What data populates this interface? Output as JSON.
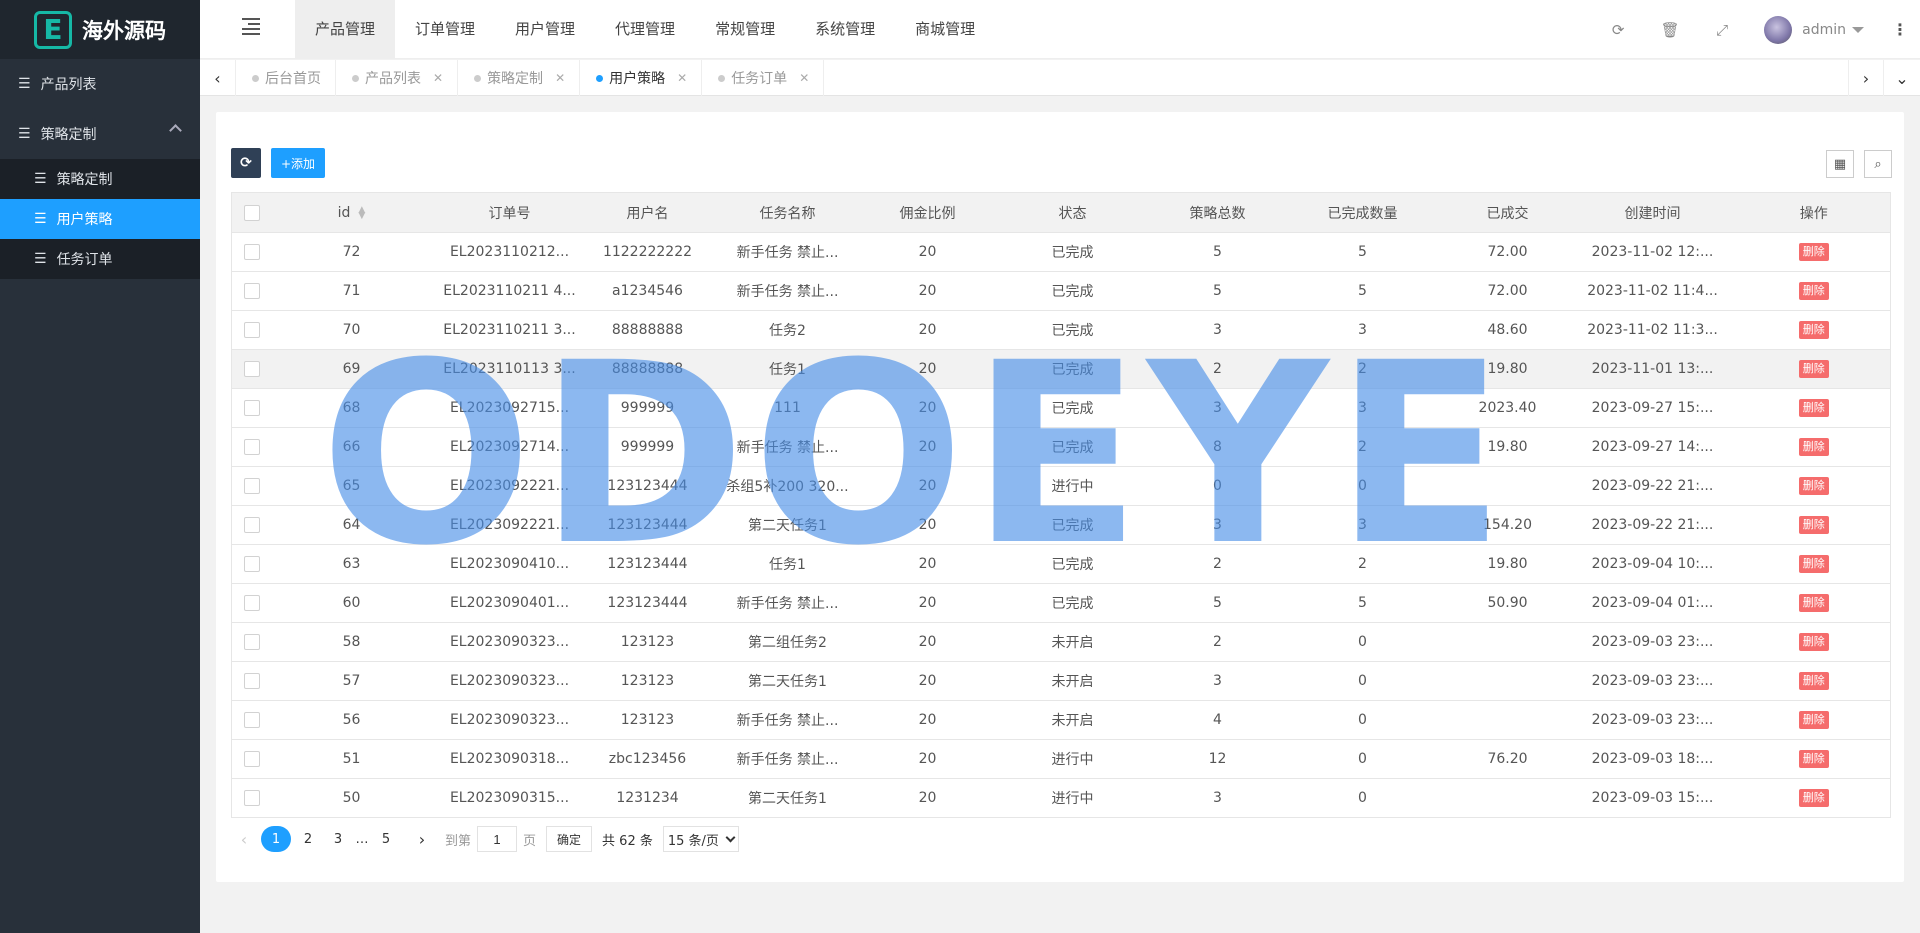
{
  "logo": {
    "badge": "E",
    "name": "海外源码"
  },
  "sidebar": {
    "items": [
      {
        "label": "产品列表"
      },
      {
        "label": "策略定制"
      }
    ],
    "submenu": [
      {
        "label": "策略定制",
        "active": false
      },
      {
        "label": "用户策略",
        "active": true
      },
      {
        "label": "任务订单",
        "active": false
      }
    ]
  },
  "header": {
    "nav": [
      "产品管理",
      "订单管理",
      "用户管理",
      "代理管理",
      "常规管理",
      "系统管理",
      "商城管理"
    ],
    "active_nav": "产品管理",
    "user": "admin"
  },
  "tabs": [
    {
      "label": "后台首页",
      "closable": false,
      "active": false
    },
    {
      "label": "产品列表",
      "closable": true,
      "active": false
    },
    {
      "label": "策略定制",
      "closable": true,
      "active": false
    },
    {
      "label": "用户策略",
      "closable": true,
      "active": true
    },
    {
      "label": "任务订单",
      "closable": true,
      "active": false
    }
  ],
  "toolbar": {
    "add_label": "+添加"
  },
  "table": {
    "columns": [
      "id",
      "订单号",
      "用户名",
      "任务名称",
      "佣金比例",
      "状态",
      "策略总数",
      "已完成数量",
      "已成交",
      "创建时间",
      "操作"
    ],
    "action_label": "删除",
    "rows": [
      {
        "id": "72",
        "order": "EL2023110212...",
        "user": "1122222222",
        "task": "新手任务 禁止...",
        "rate": "20",
        "status": "已完成",
        "total": "5",
        "done": "5",
        "deal": "72.00",
        "created": "2023-11-02 12:..."
      },
      {
        "id": "71",
        "order": "EL2023110211 4...",
        "user": "a1234546",
        "task": "新手任务 禁止...",
        "rate": "20",
        "status": "已完成",
        "total": "5",
        "done": "5",
        "deal": "72.00",
        "created": "2023-11-02 11:4..."
      },
      {
        "id": "70",
        "order": "EL2023110211 3...",
        "user": "88888888",
        "task": "任务2",
        "rate": "20",
        "status": "已完成",
        "total": "3",
        "done": "3",
        "deal": "48.60",
        "created": "2023-11-02 11:3..."
      },
      {
        "id": "69",
        "order": "EL2023110113 3...",
        "user": "88888888",
        "task": "任务1",
        "rate": "20",
        "status": "已完成",
        "total": "2",
        "done": "2",
        "deal": "19.80",
        "created": "2023-11-01 13:..."
      },
      {
        "id": "68",
        "order": "EL2023092715...",
        "user": "999999",
        "task": "111",
        "rate": "20",
        "status": "已完成",
        "total": "3",
        "done": "3",
        "deal": "2023.40",
        "created": "2023-09-27 15:..."
      },
      {
        "id": "66",
        "order": "EL2023092714...",
        "user": "999999",
        "task": "新手任务 禁止...",
        "rate": "20",
        "status": "已完成",
        "total": "8",
        "done": "2",
        "deal": "19.80",
        "created": "2023-09-27 14:..."
      },
      {
        "id": "65",
        "order": "EL2023092221...",
        "user": "123123444",
        "task": "杀组5补200 320...",
        "rate": "20",
        "status": "进行中",
        "total": "0",
        "done": "0",
        "deal": "",
        "created": "2023-09-22 21:..."
      },
      {
        "id": "64",
        "order": "EL2023092221...",
        "user": "123123444",
        "task": "第二天任务1",
        "rate": "20",
        "status": "已完成",
        "total": "3",
        "done": "3",
        "deal": "154.20",
        "created": "2023-09-22 21:..."
      },
      {
        "id": "63",
        "order": "EL2023090410...",
        "user": "123123444",
        "task": "任务1",
        "rate": "20",
        "status": "已完成",
        "total": "2",
        "done": "2",
        "deal": "19.80",
        "created": "2023-09-04 10:..."
      },
      {
        "id": "60",
        "order": "EL2023090401...",
        "user": "123123444",
        "task": "新手任务 禁止...",
        "rate": "20",
        "status": "已完成",
        "total": "5",
        "done": "5",
        "deal": "50.90",
        "created": "2023-09-04 01:..."
      },
      {
        "id": "58",
        "order": "EL2023090323...",
        "user": "123123",
        "task": "第二组任务2",
        "rate": "20",
        "status": "未开启",
        "total": "2",
        "done": "0",
        "deal": "",
        "created": "2023-09-03 23:..."
      },
      {
        "id": "57",
        "order": "EL2023090323...",
        "user": "123123",
        "task": "第二天任务1",
        "rate": "20",
        "status": "未开启",
        "total": "3",
        "done": "0",
        "deal": "",
        "created": "2023-09-03 23:..."
      },
      {
        "id": "56",
        "order": "EL2023090323...",
        "user": "123123",
        "task": "新手任务 禁止...",
        "rate": "20",
        "status": "未开启",
        "total": "4",
        "done": "0",
        "deal": "",
        "created": "2023-09-03 23:..."
      },
      {
        "id": "51",
        "order": "EL2023090318...",
        "user": "zbc123456",
        "task": "新手任务 禁止...",
        "rate": "20",
        "status": "进行中",
        "total": "12",
        "done": "0",
        "deal": "76.20",
        "created": "2023-09-03 18:..."
      },
      {
        "id": "50",
        "order": "EL2023090315...",
        "user": "1231234",
        "task": "第二天任务1",
        "rate": "20",
        "status": "进行中",
        "total": "3",
        "done": "0",
        "deal": "",
        "created": "2023-09-03 15:..."
      }
    ]
  },
  "pagination": {
    "pages": [
      "1",
      "2",
      "3",
      "…",
      "5"
    ],
    "current": "1",
    "goto_label": "到第",
    "page_input": "1",
    "page_suffix": "页",
    "confirm": "确定",
    "total": "共 62 条",
    "page_size": "15 条/页"
  },
  "watermark": {
    "text": "ODOEYE"
  },
  "colors": {
    "accent": "#1e9fff",
    "sidebar": "#28303a",
    "danger": "#f56c6c"
  }
}
